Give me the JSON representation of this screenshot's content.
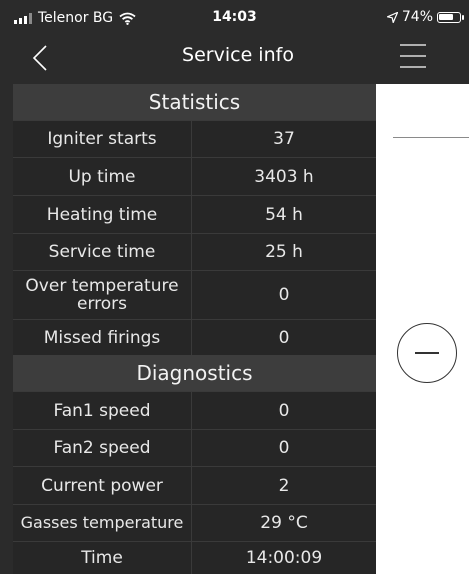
{
  "status_bar": {
    "carrier": "Telenor BG",
    "time": "14:03",
    "battery": "74%",
    "battery_level": 0.74,
    "icons": [
      "signal-icon",
      "wifi-icon",
      "location-arrow-icon",
      "battery-icon"
    ]
  },
  "nav": {
    "back_icon": "chevron-left-icon",
    "title": "Service info",
    "menu_icon": "hamburger-menu-icon"
  },
  "statistics": {
    "title": "Statistics",
    "rows": [
      {
        "label": "Igniter starts",
        "value": "37"
      },
      {
        "label": "Up time",
        "value": "3403 h"
      },
      {
        "label": "Heating time",
        "value": "54 h"
      },
      {
        "label": "Service time",
        "value": "25 h"
      },
      {
        "label": "Over temperature errors",
        "value": "0"
      },
      {
        "label": "Missed firings",
        "value": "0"
      }
    ]
  },
  "diagnostics": {
    "title": "Diagnostics",
    "rows": [
      {
        "label": "Fan1 speed",
        "value": "0"
      },
      {
        "label": "Fan2 speed",
        "value": "0"
      },
      {
        "label": "Current power",
        "value": "2"
      },
      {
        "label": "Gasses temperature",
        "value": "29 °C"
      },
      {
        "label": "Time",
        "value": "14:00:09"
      }
    ]
  },
  "colors": {
    "panel_bg": "#2b2b2b",
    "row_bg": "#262626",
    "header_bg": "#3d3d3d",
    "text": "#ffffff"
  }
}
